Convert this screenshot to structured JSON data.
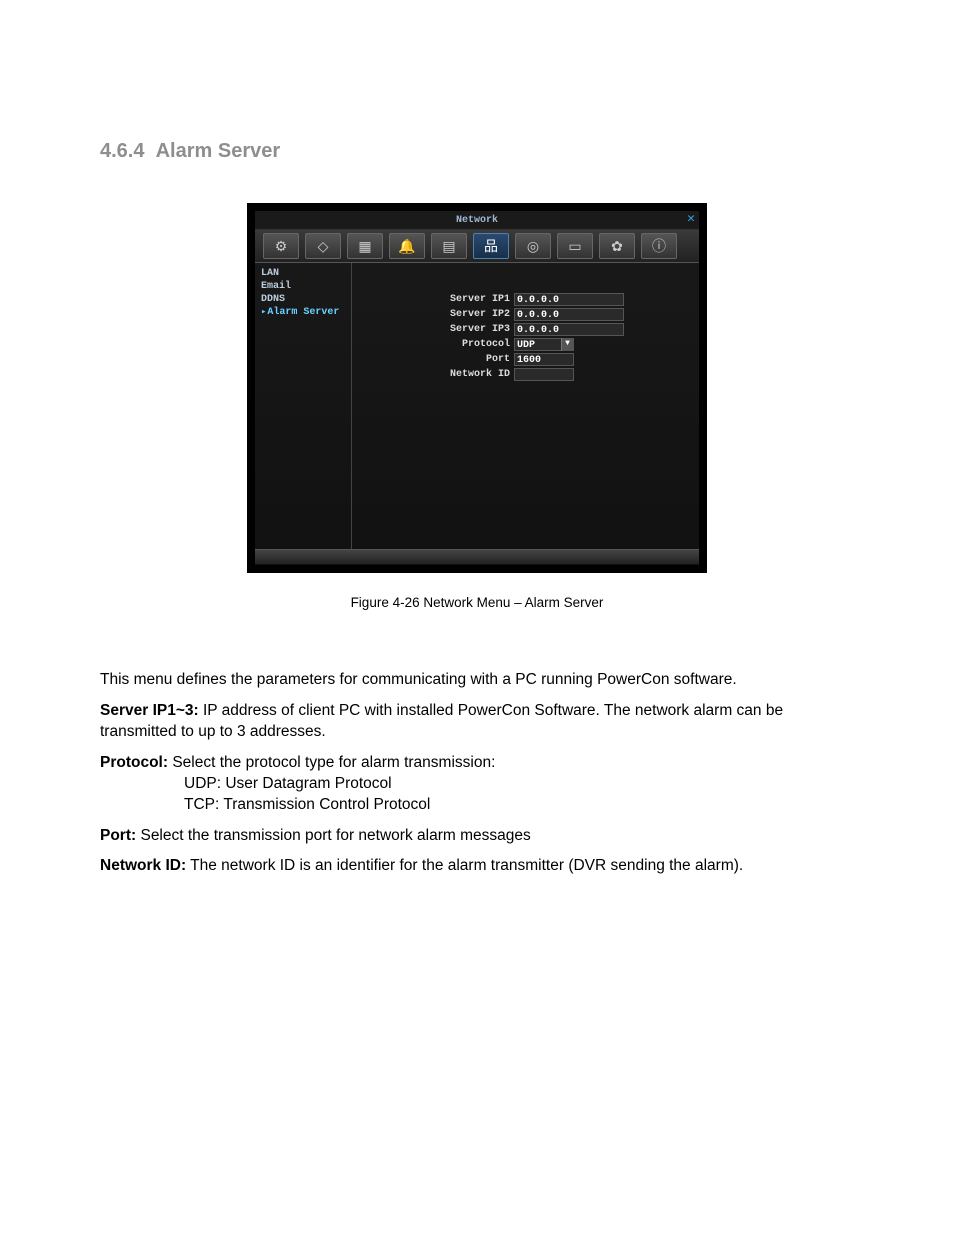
{
  "heading": {
    "number": "4.6.4",
    "title": "Alarm Server"
  },
  "dvr": {
    "window_title": "Network",
    "close_glyph": "✕",
    "toolbar_icons": [
      {
        "name": "config-icon",
        "glyph": "⚙"
      },
      {
        "name": "display-icon",
        "glyph": "◇"
      },
      {
        "name": "calendar-icon",
        "glyph": "▦"
      },
      {
        "name": "alarm-icon",
        "glyph": "🔔"
      },
      {
        "name": "storage-icon",
        "glyph": "▤"
      },
      {
        "name": "network-icon",
        "glyph": "品",
        "active": true
      },
      {
        "name": "camera-icon",
        "glyph": "◎"
      },
      {
        "name": "monitor-icon",
        "glyph": "▭"
      },
      {
        "name": "settings-icon",
        "glyph": "✿"
      },
      {
        "name": "info-icon",
        "glyph": "ⓘ"
      }
    ],
    "sidebar": [
      {
        "label": "LAN",
        "selected": false
      },
      {
        "label": "Email",
        "selected": false
      },
      {
        "label": "DDNS",
        "selected": false
      },
      {
        "label": "Alarm Server",
        "selected": true
      }
    ],
    "form": {
      "server_ip1": {
        "label": "Server IP1",
        "value": "0.0.0.0"
      },
      "server_ip2": {
        "label": "Server IP2",
        "value": "0.0.0.0"
      },
      "server_ip3": {
        "label": "Server IP3",
        "value": "0.0.0.0"
      },
      "protocol": {
        "label": "Protocol",
        "value": "UDP"
      },
      "port": {
        "label": "Port",
        "value": "1600"
      },
      "network_id": {
        "label": "Network ID",
        "value": ""
      }
    }
  },
  "caption": "Figure 4-26  Network Menu – Alarm Server",
  "body": {
    "intro": "This menu defines the parameters for communicating with a PC running PowerCon software.",
    "server_ip_label": "Server IP1~3:",
    "server_ip_text": " IP address of client PC with installed PowerCon Software. The network alarm can be transmitted to up to 3 addresses.",
    "protocol_label": "Protocol:",
    "protocol_text": " Select the protocol type for alarm transmission:",
    "protocol_udp": "UDP: User Datagram Protocol",
    "protocol_tcp": "TCP: Transmission Control Protocol",
    "port_label": "Port:",
    "port_text": " Select the transmission port for network alarm messages",
    "network_id_label": "Network ID:",
    "network_id_text": " The network ID is an identifier for the alarm transmitter (DVR sending the alarm)."
  }
}
